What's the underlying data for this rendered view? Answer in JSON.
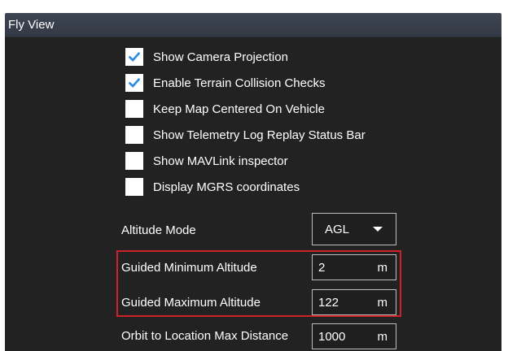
{
  "header": {
    "title": "Fly View"
  },
  "checkboxes": [
    {
      "label": "Show Camera Projection",
      "checked": true
    },
    {
      "label": "Enable Terrain Collision Checks",
      "checked": true
    },
    {
      "label": "Keep Map Centered On Vehicle",
      "checked": false
    },
    {
      "label": "Show Telemetry Log Replay Status Bar",
      "checked": false
    },
    {
      "label": "Show MAVLink inspector",
      "checked": false
    },
    {
      "label": "Display MGRS coordinates",
      "checked": false
    }
  ],
  "altitude_mode": {
    "label": "Altitude Mode",
    "value": "AGL"
  },
  "fields": [
    {
      "label": "Guided Minimum Altitude",
      "value": "2",
      "unit": "m"
    },
    {
      "label": "Guided Maximum Altitude",
      "value": "122",
      "unit": "m"
    },
    {
      "label": "Orbit to Location Max Distance",
      "value": "1000",
      "unit": "m"
    }
  ],
  "colors": {
    "header_bg": "#363c48",
    "panel_bg": "#222222",
    "checkmark": "#2b8ae6",
    "highlight_border": "#d0202a"
  }
}
